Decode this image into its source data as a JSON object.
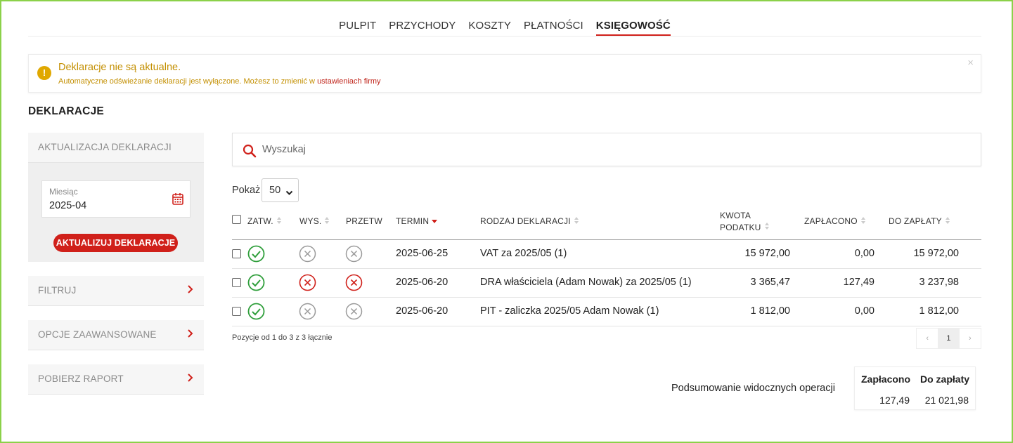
{
  "nav": {
    "tabs": [
      {
        "label": "PULPIT"
      },
      {
        "label": "PRZYCHODY"
      },
      {
        "label": "KOSZTY"
      },
      {
        "label": "PŁATNOŚCI"
      },
      {
        "label": "KSIĘGOWOŚĆ"
      }
    ],
    "active": "KSIĘGOWOŚĆ"
  },
  "alert": {
    "title": "Deklaracje nie są aktualne.",
    "message": "Automatyczne odświeżanie deklaracji jest wyłączone. Możesz to zmienić w",
    "link": "ustawieniach firmy",
    "close": "×"
  },
  "page_title": "DEKLARACJE",
  "sidebar": {
    "update_header": "AKTUALIZACJA DEKLARACJI",
    "month_label": "Miesiąc",
    "month_value": "2025-04",
    "update_button": "AKTUALIZUJ DEKLARACJE",
    "items": [
      {
        "label": "FILTRUJ"
      },
      {
        "label": "OPCJE ZAAWANSOWANE"
      },
      {
        "label": "POBIERZ RAPORT"
      }
    ]
  },
  "search": {
    "placeholder": "Wyszukaj",
    "value": ""
  },
  "show": {
    "label": "Pokaż",
    "value": "50"
  },
  "table": {
    "headers": {
      "approved": "ZATW.",
      "sent": "WYS.",
      "processed": "PRZETW",
      "deadline": "TERMIN",
      "type": "RODZAJ DEKLARACJI",
      "tax_line1": "KWOTA",
      "tax_line2": "PODATKU",
      "paid": "ZAPŁACONO",
      "due": "DO ZAPŁATY"
    },
    "rows": [
      {
        "approved": "ok",
        "sent": "neutral",
        "processed": "neutral",
        "deadline": "2025-06-25",
        "type": "VAT za 2025/05 (1)",
        "tax": "15 972,00",
        "paid": "0,00",
        "due": "15 972,00"
      },
      {
        "approved": "ok",
        "sent": "error",
        "processed": "error",
        "deadline": "2025-06-20",
        "type": "DRA właściciela (Adam Nowak) za 2025/05 (1)",
        "tax": "3 365,47",
        "paid": "127,49",
        "due": "3 237,98"
      },
      {
        "approved": "ok",
        "sent": "neutral",
        "processed": "neutral",
        "deadline": "2025-06-20",
        "type": "PIT - zaliczka 2025/05 Adam Nowak (1)",
        "tax": "1 812,00",
        "paid": "0,00",
        "due": "1 812,00"
      }
    ]
  },
  "pagination": {
    "info": "Pozycje od 1 do 3 z 3 łącznie",
    "prev": "‹",
    "current": "1",
    "next": "›"
  },
  "summary": {
    "label": "Podsumowanie widocznych operacji",
    "paid_header": "Zapłacono",
    "due_header": "Do zapłaty",
    "paid_value": "127,49",
    "due_value": "21 021,98"
  },
  "colors": {
    "accent": "#d0201a",
    "ok": "#2e9e3a",
    "error": "#d0201a",
    "neutral": "#9a9a9a",
    "warning": "#c38f00",
    "frame": "#8bd14a"
  }
}
